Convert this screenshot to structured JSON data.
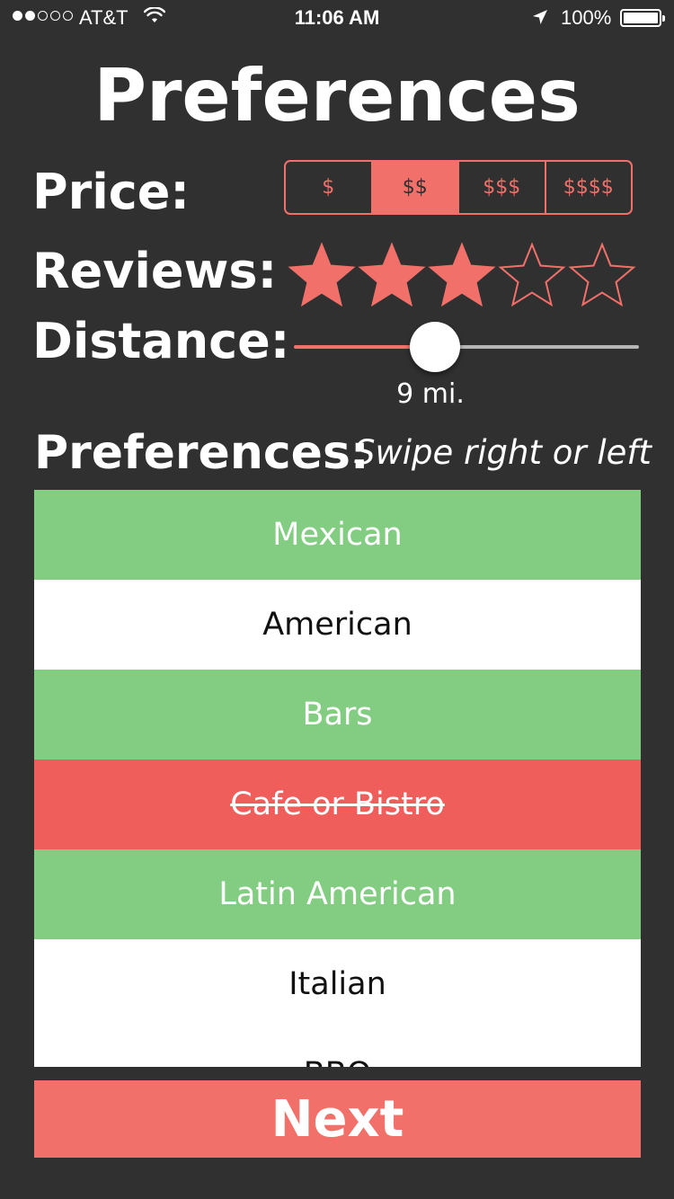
{
  "status_bar": {
    "signal_bars": [
      true,
      true,
      false,
      false,
      false
    ],
    "carrier": "AT&T",
    "time": "11:06 AM",
    "battery": "100%"
  },
  "title": "Preferences",
  "price": {
    "label": "Price:",
    "options": [
      "$",
      "$$",
      "$$$",
      "$$$$"
    ],
    "selected_index": 1
  },
  "reviews": {
    "label": "Reviews:",
    "rating": 3,
    "max": 5
  },
  "distance": {
    "label": "Distance:",
    "value_label": "9 mi.",
    "slider_fraction": 0.41
  },
  "preferences": {
    "label": "Preferences:",
    "hint": "Swipe right or left",
    "items": [
      {
        "name": "Mexican",
        "state": "liked"
      },
      {
        "name": "American",
        "state": "neutral"
      },
      {
        "name": "Bars",
        "state": "liked"
      },
      {
        "name": "Cafe or Bistro",
        "state": "disliked"
      },
      {
        "name": "Latin American",
        "state": "liked"
      },
      {
        "name": "Italian",
        "state": "neutral"
      },
      {
        "name": "BBQ",
        "state": "neutral"
      }
    ]
  },
  "next_button": "Next",
  "colors": {
    "accent": "#f2706a",
    "liked": "#82cd81",
    "disliked": "#f05e5b",
    "background": "#303030"
  }
}
